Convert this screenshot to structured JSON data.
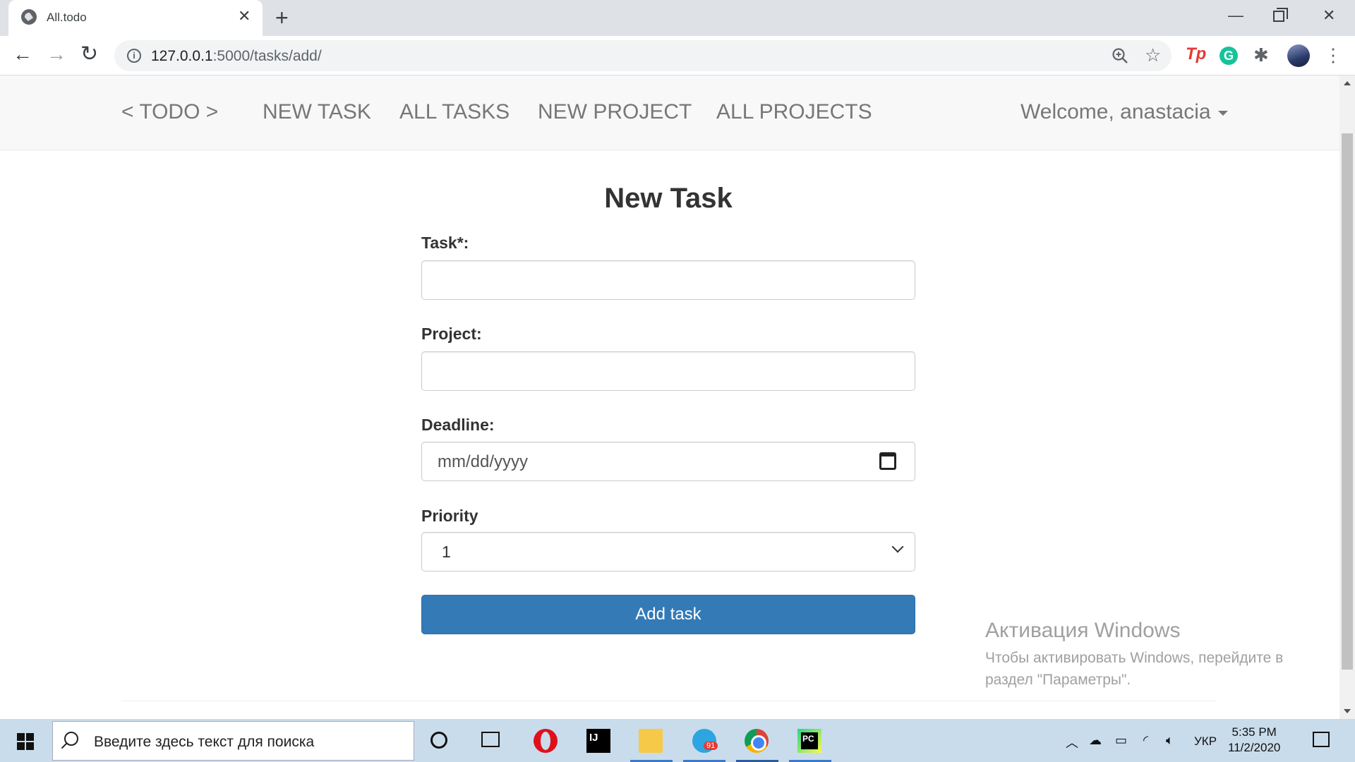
{
  "browser": {
    "tab_title": "All.todo",
    "tab_close": "✕",
    "new_tab": "+",
    "url_host": "127.0.0.1",
    "url_path": ":5000/tasks/add/"
  },
  "navbar": {
    "brand": "< TODO >",
    "links": [
      "NEW TASK",
      "ALL TASKS",
      "NEW PROJECT",
      "ALL PROJECTS"
    ],
    "welcome": "Welcome, anastacia"
  },
  "form": {
    "title": "New Task",
    "task_label": "Task*:",
    "task_value": "",
    "project_label": "Project:",
    "project_value": "",
    "deadline_label": "Deadline:",
    "deadline_placeholder": "mm/dd/yyyy",
    "priority_label": "Priority",
    "priority_value": "1",
    "submit_label": "Add task"
  },
  "watermark": {
    "title": "Активация Windows",
    "line1": "Чтобы активировать Windows, перейдите в",
    "line2": "раздел \"Параметры\"."
  },
  "taskbar": {
    "search_placeholder": "Введите здесь текст для поиска",
    "telegram_badge": "91",
    "language": "УКР",
    "time": "5:35 PM",
    "date": "11/2/2020"
  },
  "colors": {
    "primary_button": "#337ab7",
    "navbar_bg": "#f8f8f8",
    "taskbar_bg": "#c9dceb"
  },
  "icons": [
    "globe-icon",
    "close-icon",
    "plus-icon",
    "back-icon",
    "forward-icon",
    "reload-icon",
    "info-icon",
    "zoom-icon",
    "star-icon",
    "puzzle-icon",
    "calendar-icon",
    "chevron-down-icon",
    "windows-start-icon",
    "search-icon"
  ]
}
